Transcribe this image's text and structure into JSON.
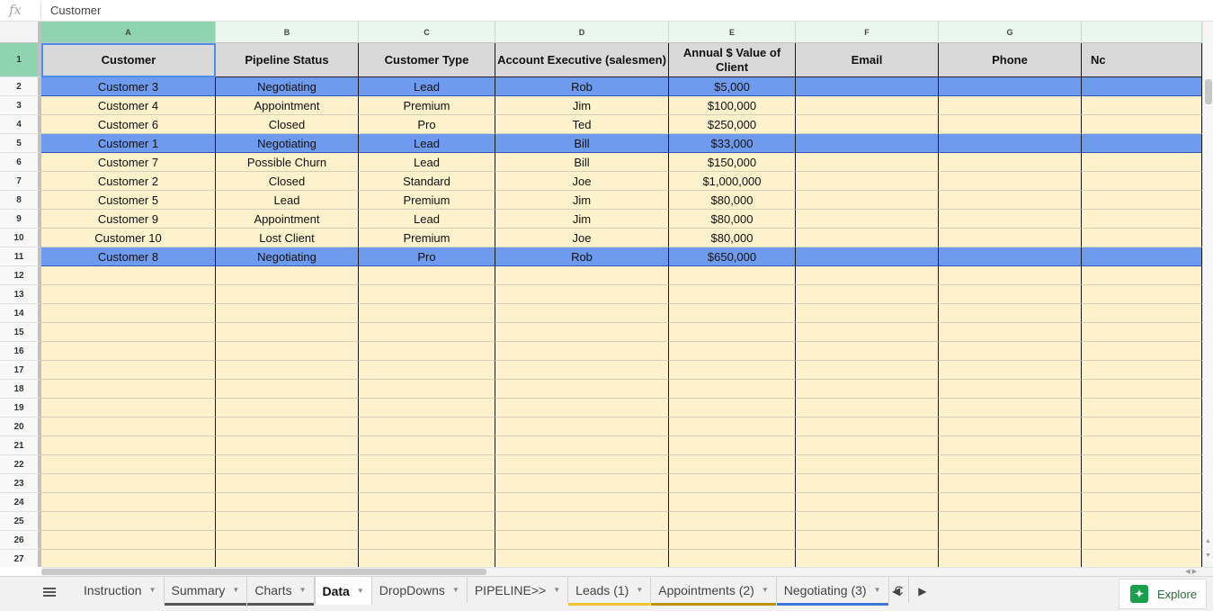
{
  "formula_bar": {
    "fx_label": "fx",
    "value": "Customer"
  },
  "columns": [
    "A",
    "B",
    "C",
    "D",
    "E",
    "F",
    "G",
    ""
  ],
  "header_row": {
    "row_number": "1",
    "cells": [
      "Customer",
      "Pipeline Status",
      "Customer Type",
      "Account Executive (salesmen)",
      "Annual $ Value of Client",
      "Email",
      "Phone",
      "Nc"
    ]
  },
  "rows": [
    {
      "num": "2",
      "cells": [
        "Customer 3",
        "Negotiating",
        "Lead",
        "Rob",
        "$5,000"
      ],
      "highlight": true
    },
    {
      "num": "3",
      "cells": [
        "Customer 4",
        "Appointment",
        "Premium",
        "Jim",
        "$100,000"
      ],
      "highlight": false
    },
    {
      "num": "4",
      "cells": [
        "Customer 6",
        "Closed",
        "Pro",
        "Ted",
        "$250,000"
      ],
      "highlight": false
    },
    {
      "num": "5",
      "cells": [
        "Customer 1",
        "Negotiating",
        "Lead",
        "Bill",
        "$33,000"
      ],
      "highlight": true
    },
    {
      "num": "6",
      "cells": [
        "Customer 7",
        "Possible Churn",
        "Lead",
        "Bill",
        "$150,000"
      ],
      "highlight": false
    },
    {
      "num": "7",
      "cells": [
        "Customer 2",
        "Closed",
        "Standard",
        "Joe",
        "$1,000,000"
      ],
      "highlight": false
    },
    {
      "num": "8",
      "cells": [
        "Customer 5",
        "Lead",
        "Premium",
        "Jim",
        "$80,000"
      ],
      "highlight": false
    },
    {
      "num": "9",
      "cells": [
        "Customer 9",
        "Appointment",
        "Lead",
        "Jim",
        "$80,000"
      ],
      "highlight": false
    },
    {
      "num": "10",
      "cells": [
        "Customer 10",
        "Lost Client",
        "Premium",
        "Joe",
        "$80,000"
      ],
      "highlight": false
    },
    {
      "num": "11",
      "cells": [
        "Customer 8",
        "Negotiating",
        "Pro",
        "Rob",
        "$650,000"
      ],
      "highlight": true
    }
  ],
  "empty_row_numbers": [
    "12",
    "13",
    "14",
    "15",
    "16",
    "17",
    "18",
    "19",
    "20",
    "21",
    "22",
    "23",
    "24",
    "25",
    "26",
    "27"
  ],
  "tabs": [
    {
      "label": "Instruction",
      "active": false,
      "underline": ""
    },
    {
      "label": "Summary",
      "active": false,
      "underline": "#555555"
    },
    {
      "label": "Charts",
      "active": false,
      "underline": "#555555"
    },
    {
      "label": "Data",
      "active": true,
      "underline": ""
    },
    {
      "label": "DropDowns",
      "active": false,
      "underline": ""
    },
    {
      "label": "PIPELINE>>",
      "active": false,
      "underline": ""
    },
    {
      "label": "Leads (1)",
      "active": false,
      "underline": "#f1c232"
    },
    {
      "label": "Appointments (2)",
      "active": false,
      "underline": "#bf9000"
    },
    {
      "label": "Negotiating (3)",
      "active": false,
      "underline": "#3c78d8"
    },
    {
      "label": "C",
      "active": false,
      "underline": "#6aa84f",
      "clipped": true
    }
  ],
  "explore_label": "Explore",
  "colors": {
    "highlight_row": "#6f9bef",
    "data_cell": "#fdf2cc",
    "header_cell": "#d9d9d9",
    "active_header": "#8fd4b0"
  }
}
